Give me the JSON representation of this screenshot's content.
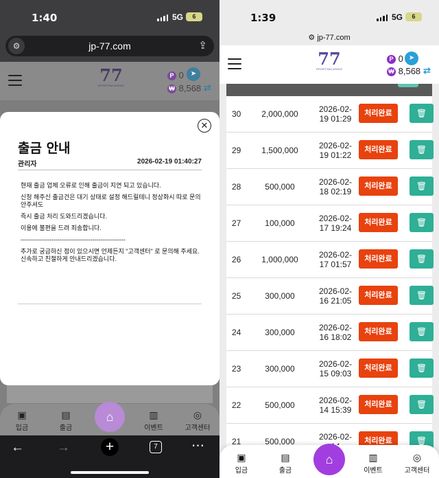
{
  "left": {
    "status": {
      "time": "1:40",
      "network": "5G",
      "battery": "6"
    },
    "url": "jp-77.com",
    "site_icon": "site-settings-icon",
    "header": {
      "logo": "77",
      "logo_sub": "SPORTS&CASINO",
      "points": "0",
      "balance": "8,568"
    },
    "notice": {
      "title": "출금 안내",
      "author": "관리자",
      "date": "2026-02-19 01:40:27",
      "lines": [
        "현재 출금 업체 오류로 인해 출금이 지연 되고 있습니다.",
        "신청 해주신 출금건은 대기 상태로 설정 해드릴테니 정상화시 따로 문의 안주셔도",
        "즉시 출금 처리 도와드리겠습니다.",
        "이용에 불편을 드려 죄송합니다.",
        "---------------------------------------------------",
        "추가로 궁금하신 점이 있으시면 언제든지 \"고객센터\" 로 문의해 주세요. 신속하고 친절하게 안내드리겠습니다."
      ]
    },
    "nav": {
      "deposit": "입금",
      "withdraw": "출금",
      "event": "이벤트",
      "support": "고객센터"
    },
    "browser": {
      "tab_count": "7"
    }
  },
  "right": {
    "status": {
      "time": "1:39",
      "network": "5G",
      "battery": "6"
    },
    "url": "jp-77.com",
    "header": {
      "logo": "77",
      "logo_sub": "SPORTS&CASINO",
      "points": "0",
      "balance": "8,568"
    },
    "status_label": "처리완료",
    "rows": [
      {
        "id": "30",
        "amount": "2,000,000",
        "date1": "2026-02-",
        "date2": "19 01:29"
      },
      {
        "id": "29",
        "amount": "1,500,000",
        "date1": "2026-02-",
        "date2": "19 01:22"
      },
      {
        "id": "28",
        "amount": "500,000",
        "date1": "2026-02-",
        "date2": "18 02:19"
      },
      {
        "id": "27",
        "amount": "100,000",
        "date1": "2026-02-",
        "date2": "17 19:24"
      },
      {
        "id": "26",
        "amount": "1,000,000",
        "date1": "2026-02-",
        "date2": "17 01:57"
      },
      {
        "id": "25",
        "amount": "300,000",
        "date1": "2026-02-",
        "date2": "16 21:05"
      },
      {
        "id": "24",
        "amount": "300,000",
        "date1": "2026-02-",
        "date2": "16 18:02"
      },
      {
        "id": "23",
        "amount": "300,000",
        "date1": "2026-02-",
        "date2": "15 09:03"
      },
      {
        "id": "22",
        "amount": "500,000",
        "date1": "2026-02-",
        "date2": "14 15:39"
      },
      {
        "id": "21",
        "amount": "500,000",
        "date1": "2026-02-",
        "date2": "14"
      }
    ],
    "nav": {
      "deposit": "입금",
      "withdraw": "출금",
      "event": "이벤트",
      "support": "고객센터"
    }
  },
  "colors": {
    "status_done": "#e8420e",
    "delete": "#2faf96",
    "home_purple": "#a23ee0",
    "telegram": "#2b9fd9"
  }
}
